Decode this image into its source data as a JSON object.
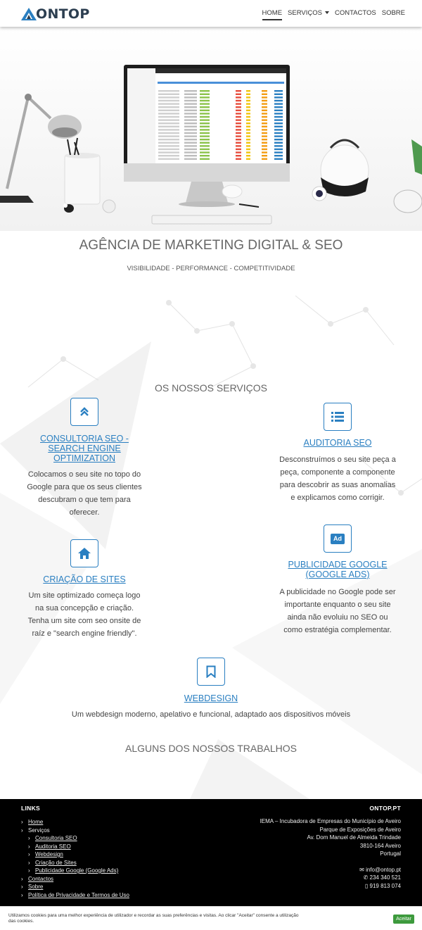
{
  "brand": {
    "name": "ONTOP",
    "accent": "#2a7fc1",
    "logo_dark": "#2c3e50"
  },
  "nav": {
    "items": [
      {
        "label": "HOME",
        "active": true
      },
      {
        "label": "SERVIÇOS",
        "dropdown": true
      },
      {
        "label": "CONTACTOS"
      },
      {
        "label": "SOBRE"
      }
    ]
  },
  "hero": {
    "headline": "AGÊNCIA DE MARKETING DIGITAL & SEO",
    "tagline": "VISIBILIDADE - PERFORMANCE - COMPETITIVIDADE"
  },
  "services": {
    "title": "OS NOSSOS SERVIÇOS",
    "items": [
      {
        "icon": "chevrons-up-icon",
        "title_lines": [
          "CONSULTORIA SEO -",
          "SEARCH ENGINE",
          "OPTIMIZATION"
        ],
        "desc_lines": [
          "Colocamos o seu site no topo do",
          "Google para que os seus clientes",
          "descubram o que tem para",
          "oferecer."
        ]
      },
      {
        "icon": "list-icon",
        "title_lines": [
          "AUDITORIA SEO"
        ],
        "desc_lines": [
          "Desconstruímos o seu site peça a",
          "peça, componente a componente",
          "para descobrir as suas anomalias",
          "e explicamos como corrigir."
        ]
      },
      {
        "icon": "home-icon",
        "title_lines": [
          "CRIAÇÃO DE SITES"
        ],
        "desc_lines": [
          "Um site optimizado começa logo",
          "na sua concepção e criação.",
          "Tenha um site com seo onsite de",
          "raíz e \"search engine friendly\"."
        ]
      },
      {
        "icon": "ad-icon",
        "icon_text": "Ad",
        "title_lines": [
          "PUBLICIDADE GOOGLE",
          "(GOOGLE ADS)"
        ],
        "desc_lines": [
          "A publicidade no Google pode ser",
          "importante enquanto o seu site",
          "ainda não evoluiu no SEO ou",
          "como estratégia complementar."
        ]
      },
      {
        "icon": "bookmark-icon",
        "title_lines": [
          "WEBDESIGN"
        ],
        "desc_lines": [
          "Um webdesign moderno, apelativo e funcional, adaptado aos dispositivos móveis"
        ]
      }
    ]
  },
  "works": {
    "title": "ALGUNS DOS NOSSOS TRABALHOS"
  },
  "footer": {
    "links_title": "LINKS",
    "links": [
      {
        "label": "Home",
        "level": 0,
        "link": true
      },
      {
        "label": "Serviços",
        "level": 0,
        "link": false
      },
      {
        "label": "Consultoria SEO",
        "level": 1,
        "link": true
      },
      {
        "label": "Auditoria SEO",
        "level": 1,
        "link": true
      },
      {
        "label": "Webdesign",
        "level": 1,
        "link": true
      },
      {
        "label": "Criação de Sites",
        "level": 1,
        "link": true
      },
      {
        "label": "Publicidade Google (Google Ads)",
        "level": 1,
        "link": true
      },
      {
        "label": "Contactos",
        "level": 0,
        "link": true
      },
      {
        "label": "Sobre",
        "level": 0,
        "link": true
      },
      {
        "label": "Política de Privacidade e Termos de Uso",
        "level": 0,
        "link": true
      }
    ],
    "company_title": "ONTOP.PT",
    "address_lines": [
      "IEMA – Incubadora de Empresas do Município de Aveiro",
      "Parque de Exposições de Aveiro",
      "Av. Dom Manuel de Almeida Trindade",
      "3810-164 Aveiro",
      "Portugal"
    ],
    "email": "info@ontop.pt",
    "phone": "234 340 521",
    "mobile": "919 813 074"
  },
  "cookie": {
    "text": "Utilizamos cookies para uma melhor experiência de utilizador e recordar as suas preferências e visitas. Ao clicar \"Aceitar\" consente a utilização das cookies.",
    "accept_label": "Aceitar",
    "accept_color": "#3d9a3d"
  }
}
